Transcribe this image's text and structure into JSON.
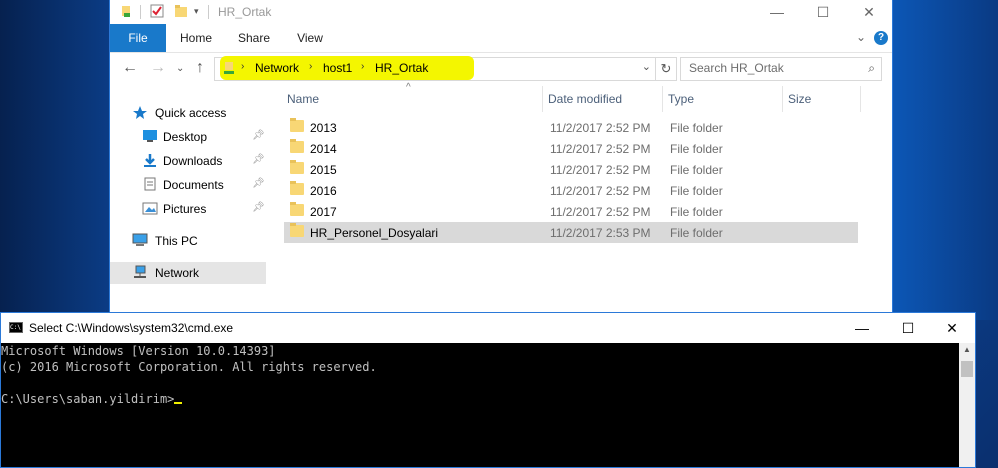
{
  "explorer": {
    "title": "HR_Ortak",
    "ribbon_tabs": [
      "File",
      "Home",
      "Share",
      "View"
    ],
    "help": "?",
    "address": {
      "crumbs": [
        "Network",
        "host1",
        "HR_Ortak"
      ],
      "highlight_color": "#f4f600"
    },
    "search_placeholder": "Search HR_Ortak",
    "nav_pane": {
      "items": [
        {
          "label": "Quick access",
          "icon": "star-icon"
        },
        {
          "label": "Desktop",
          "icon": "desktop-icon",
          "pinned": true
        },
        {
          "label": "Downloads",
          "icon": "download-icon",
          "pinned": true
        },
        {
          "label": "Documents",
          "icon": "documents-icon",
          "pinned": true
        },
        {
          "label": "Pictures",
          "icon": "pictures-icon",
          "pinned": true
        },
        {
          "label": "This PC",
          "icon": "computer-icon"
        },
        {
          "label": "Network",
          "icon": "network-icon",
          "selected": true
        }
      ]
    },
    "columns": [
      "Name",
      "Date modified",
      "Type",
      "Size"
    ],
    "files": [
      {
        "name": "2013",
        "date": "11/2/2017 2:52 PM",
        "type": "File folder"
      },
      {
        "name": "2014",
        "date": "11/2/2017 2:52 PM",
        "type": "File folder"
      },
      {
        "name": "2015",
        "date": "11/2/2017 2:52 PM",
        "type": "File folder"
      },
      {
        "name": "2016",
        "date": "11/2/2017 2:52 PM",
        "type": "File folder"
      },
      {
        "name": "2017",
        "date": "11/2/2017 2:52 PM",
        "type": "File folder"
      },
      {
        "name": "HR_Personel_Dosyalari",
        "date": "11/2/2017 2:53 PM",
        "type": "File folder",
        "selected": true
      }
    ]
  },
  "cmd": {
    "title": "Select C:\\Windows\\system32\\cmd.exe",
    "lines": [
      "Microsoft Windows [Version 10.0.14393]",
      "(c) 2016 Microsoft Corporation. All rights reserved.",
      "",
      "C:\\Users\\saban.yildirim>"
    ]
  }
}
